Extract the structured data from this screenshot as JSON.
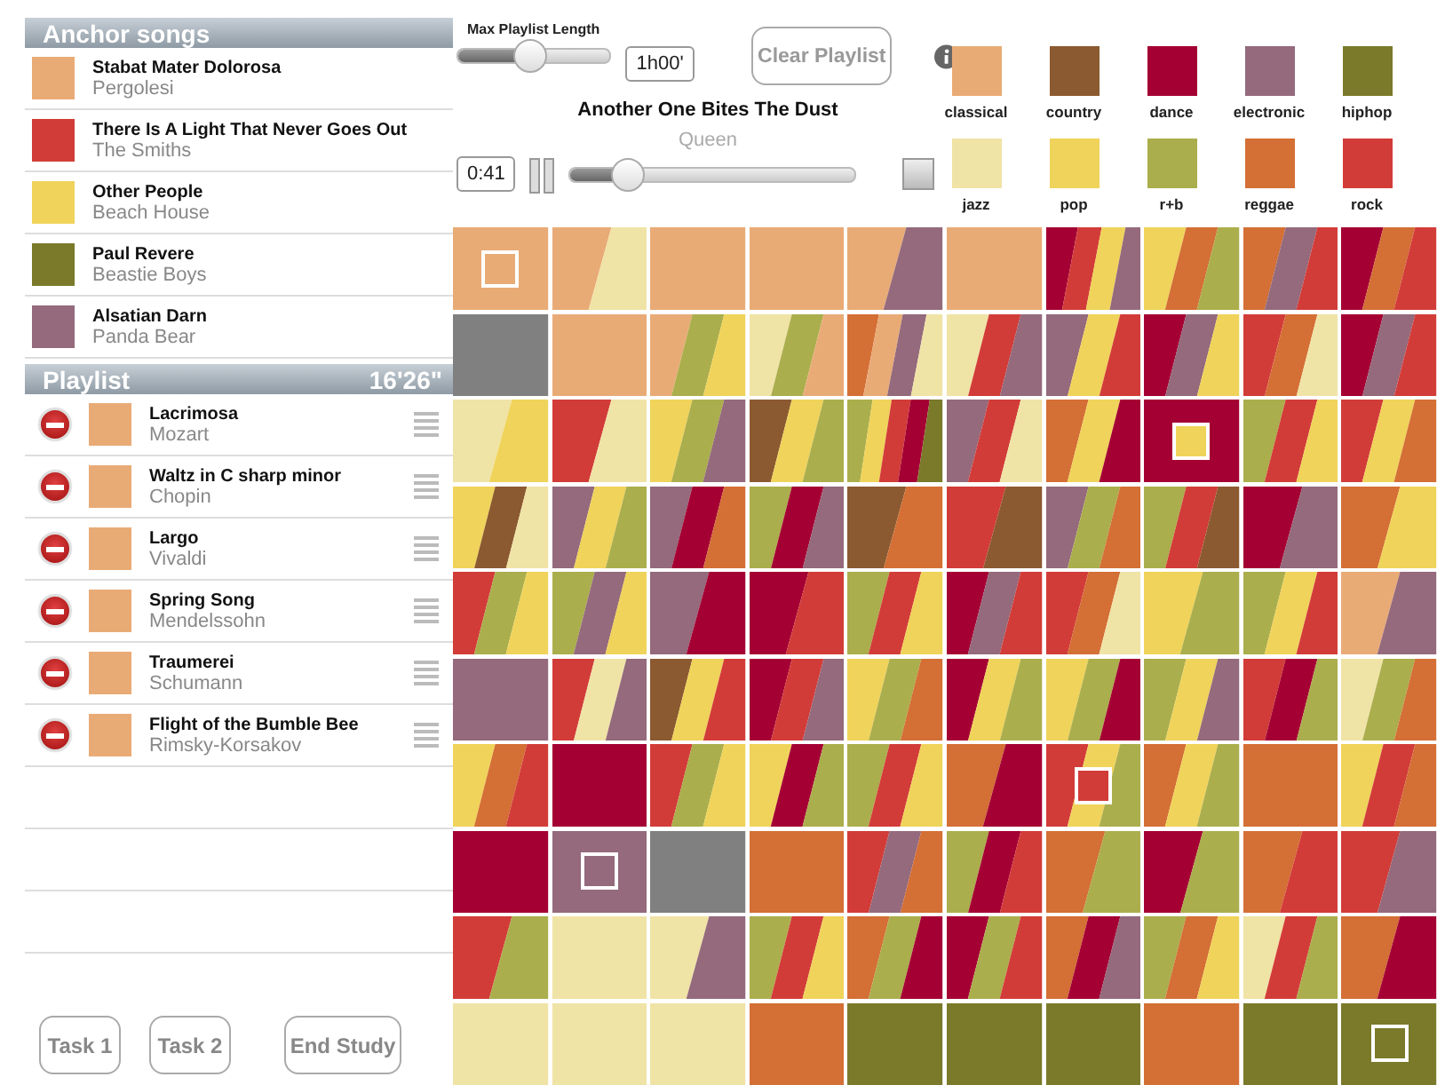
{
  "anchors": {
    "title": "Anchor songs",
    "songs": [
      {
        "title": "Stabat Mater Dolorosa",
        "artist": "Pergolesi",
        "color": "#e9ab76"
      },
      {
        "title": "There Is A Light That Never Goes Out",
        "artist": "The Smiths",
        "color": "#d23c38"
      },
      {
        "title": "Other People",
        "artist": "Beach House",
        "color": "#f0d35a"
      },
      {
        "title": "Paul Revere",
        "artist": "Beastie Boys",
        "color": "#7a7a2a"
      },
      {
        "title": "Alsatian Darn",
        "artist": "Panda Bear",
        "color": "#946a7c"
      }
    ]
  },
  "playlist": {
    "title": "Playlist",
    "duration": "16'26\"",
    "songs": [
      {
        "title": "Lacrimosa",
        "artist": "Mozart",
        "color": "#e9ab76"
      },
      {
        "title": "Waltz in C sharp minor",
        "artist": "Chopin",
        "color": "#e9ab76"
      },
      {
        "title": "Largo",
        "artist": "Vivaldi",
        "color": "#e9ab76"
      },
      {
        "title": "Spring Song",
        "artist": "Mendelssohn",
        "color": "#e9ab76"
      },
      {
        "title": "Traumerei",
        "artist": "Schumann",
        "color": "#e9ab76"
      },
      {
        "title": "Flight of the Bumble Bee",
        "artist": "Rimsky-Korsakov",
        "color": "#e9ab76"
      }
    ]
  },
  "buttons": [
    "Task 1",
    "Task 2",
    "End Study"
  ],
  "controls": {
    "max_length_label": "Max Playlist Length",
    "max_length": {
      "level": 0.47
    },
    "max_length_value": "1h00'",
    "clear_button": "Clear Playlist"
  },
  "player": {
    "title": "Another One Bites The Dust",
    "artist": "Queen",
    "time": "0:41",
    "progress": {
      "level": 0.2
    }
  },
  "genres": [
    {
      "name": "classical",
      "color": "#e9ab76"
    },
    {
      "name": "country",
      "color": "#8c5a30"
    },
    {
      "name": "dance",
      "color": "#a50033"
    },
    {
      "name": "electronic",
      "color": "#946a7c"
    },
    {
      "name": "hiphop",
      "color": "#7a7a2a"
    },
    {
      "name": "jazz",
      "color": "#f0e3a6"
    },
    {
      "name": "pop",
      "color": "#f0d35a"
    },
    {
      "name": "r+b",
      "color": "#abae4c"
    },
    {
      "name": "reggae",
      "color": "#d46f35"
    },
    {
      "name": "rock",
      "color": "#d23c38"
    }
  ],
  "grid": [
    {
      "bands": [
        {
          "color": "#e9ab76"
        }
      ],
      "anchor": true
    },
    {
      "bands": [
        {
          "color": "#e9ab76"
        },
        {
          "color": "#f0e3a6"
        }
      ],
      "anchor": false
    },
    {
      "bands": [
        {
          "color": "#e9ab76"
        }
      ],
      "anchor": false
    },
    {
      "bands": [
        {
          "color": "#e9ab76"
        }
      ],
      "anchor": false
    },
    {
      "bands": [
        {
          "color": "#e9ab76"
        },
        {
          "color": "#946a7c"
        }
      ],
      "anchor": false
    },
    {
      "bands": [
        {
          "color": "#e9ab76"
        }
      ],
      "anchor": false
    },
    {
      "bands": [
        {
          "color": "#a50033"
        },
        {
          "color": "#d23c38"
        },
        {
          "color": "#f0d35a"
        },
        {
          "color": "#946a7c"
        }
      ],
      "anchor": false
    },
    {
      "bands": [
        {
          "color": "#f0d35a"
        },
        {
          "color": "#d46f35"
        },
        {
          "color": "#abae4c"
        }
      ],
      "anchor": false
    },
    {
      "bands": [
        {
          "color": "#d46f35"
        },
        {
          "color": "#946a7c"
        },
        {
          "color": "#d23c38"
        }
      ],
      "anchor": false
    },
    {
      "bands": [
        {
          "color": "#a50033"
        },
        {
          "color": "#d46f35"
        },
        {
          "color": "#d23c38"
        }
      ],
      "anchor": false
    },
    {
      "bands": [
        {
          "color": "#808080"
        }
      ],
      "anchor": false
    },
    {
      "bands": [
        {
          "color": "#e9ab76"
        }
      ],
      "anchor": false
    },
    {
      "bands": [
        {
          "color": "#e9ab76"
        },
        {
          "color": "#abae4c"
        },
        {
          "color": "#f0d35a"
        }
      ],
      "anchor": false
    },
    {
      "bands": [
        {
          "color": "#f0e3a6"
        },
        {
          "color": "#abae4c"
        },
        {
          "color": "#e9ab76"
        }
      ],
      "anchor": false
    },
    {
      "bands": [
        {
          "color": "#d46f35"
        },
        {
          "color": "#e9ab76"
        },
        {
          "color": "#946a7c"
        },
        {
          "color": "#f0e3a6"
        }
      ],
      "anchor": false
    },
    {
      "bands": [
        {
          "color": "#f0e3a6"
        },
        {
          "color": "#d23c38"
        },
        {
          "color": "#946a7c"
        }
      ],
      "anchor": false
    },
    {
      "bands": [
        {
          "color": "#946a7c"
        },
        {
          "color": "#f0d35a"
        },
        {
          "color": "#d23c38"
        }
      ],
      "anchor": false
    },
    {
      "bands": [
        {
          "color": "#a50033"
        },
        {
          "color": "#946a7c"
        },
        {
          "color": "#f0d35a"
        }
      ],
      "anchor": false
    },
    {
      "bands": [
        {
          "color": "#d23c38"
        },
        {
          "color": "#d46f35"
        },
        {
          "color": "#f0e3a6"
        }
      ],
      "anchor": false
    },
    {
      "bands": [
        {
          "color": "#a50033"
        },
        {
          "color": "#946a7c"
        },
        {
          "color": "#d23c38"
        }
      ],
      "anchor": false
    },
    {
      "bands": [
        {
          "color": "#f0e3a6"
        },
        {
          "color": "#f0d35a"
        }
      ],
      "anchor": false
    },
    {
      "bands": [
        {
          "color": "#d23c38"
        },
        {
          "color": "#f0e3a6"
        }
      ],
      "anchor": false
    },
    {
      "bands": [
        {
          "color": "#f0d35a"
        },
        {
          "color": "#abae4c"
        },
        {
          "color": "#946a7c"
        }
      ],
      "anchor": false
    },
    {
      "bands": [
        {
          "color": "#8c5a30"
        },
        {
          "color": "#f0d35a"
        },
        {
          "color": "#abae4c"
        }
      ],
      "anchor": false
    },
    {
      "bands": [
        {
          "color": "#abae4c"
        },
        {
          "color": "#f0d35a"
        },
        {
          "color": "#d23c38"
        },
        {
          "color": "#a50033"
        },
        {
          "color": "#7a7a2a"
        }
      ],
      "anchor": false
    },
    {
      "bands": [
        {
          "color": "#946a7c"
        },
        {
          "color": "#d23c38"
        },
        {
          "color": "#f0e3a6"
        }
      ],
      "anchor": false
    },
    {
      "bands": [
        {
          "color": "#d46f35"
        },
        {
          "color": "#f0d35a"
        },
        {
          "color": "#a50033"
        }
      ],
      "anchor": false
    },
    {
      "bands": [
        {
          "color": "#a50033"
        }
      ],
      "anchor": true,
      "marker": {
        "color": "#f0d35a"
      }
    },
    {
      "bands": [
        {
          "color": "#abae4c"
        },
        {
          "color": "#d23c38"
        },
        {
          "color": "#f0d35a"
        }
      ],
      "anchor": false
    },
    {
      "bands": [
        {
          "color": "#d23c38"
        },
        {
          "color": "#f0d35a"
        },
        {
          "color": "#d46f35"
        }
      ],
      "anchor": false
    },
    {
      "bands": [
        {
          "color": "#f0d35a"
        },
        {
          "color": "#8c5a30"
        },
        {
          "color": "#f0e3a6"
        }
      ],
      "anchor": false
    },
    {
      "bands": [
        {
          "color": "#946a7c"
        },
        {
          "color": "#f0d35a"
        },
        {
          "color": "#abae4c"
        }
      ],
      "anchor": false
    },
    {
      "bands": [
        {
          "color": "#946a7c"
        },
        {
          "color": "#a50033"
        },
        {
          "color": "#d46f35"
        }
      ],
      "anchor": false
    },
    {
      "bands": [
        {
          "color": "#abae4c"
        },
        {
          "color": "#a50033"
        },
        {
          "color": "#946a7c"
        }
      ],
      "anchor": false
    },
    {
      "bands": [
        {
          "color": "#8c5a30"
        },
        {
          "color": "#d46f35"
        }
      ],
      "anchor": false
    },
    {
      "bands": [
        {
          "color": "#d23c38"
        },
        {
          "color": "#8c5a30"
        }
      ],
      "anchor": false
    },
    {
      "bands": [
        {
          "color": "#946a7c"
        },
        {
          "color": "#abae4c"
        },
        {
          "color": "#d46f35"
        }
      ],
      "anchor": false
    },
    {
      "bands": [
        {
          "color": "#abae4c"
        },
        {
          "color": "#d23c38"
        },
        {
          "color": "#8c5a30"
        }
      ],
      "anchor": false
    },
    {
      "bands": [
        {
          "color": "#a50033"
        },
        {
          "color": "#946a7c"
        }
      ],
      "anchor": false
    },
    {
      "bands": [
        {
          "color": "#d46f35"
        },
        {
          "color": "#f0d35a"
        }
      ],
      "anchor": false
    },
    {
      "bands": [
        {
          "color": "#d23c38"
        },
        {
          "color": "#abae4c"
        },
        {
          "color": "#f0d35a"
        }
      ],
      "anchor": false
    },
    {
      "bands": [
        {
          "color": "#abae4c"
        },
        {
          "color": "#946a7c"
        },
        {
          "color": "#f0d35a"
        }
      ],
      "anchor": false
    },
    {
      "bands": [
        {
          "color": "#946a7c"
        },
        {
          "color": "#a50033"
        }
      ],
      "anchor": false
    },
    {
      "bands": [
        {
          "color": "#a50033"
        },
        {
          "color": "#d23c38"
        }
      ],
      "anchor": false
    },
    {
      "bands": [
        {
          "color": "#abae4c"
        },
        {
          "color": "#d23c38"
        },
        {
          "color": "#f0d35a"
        }
      ],
      "anchor": false
    },
    {
      "bands": [
        {
          "color": "#a50033"
        },
        {
          "color": "#946a7c"
        },
        {
          "color": "#d23c38"
        }
      ],
      "anchor": false
    },
    {
      "bands": [
        {
          "color": "#d23c38"
        },
        {
          "color": "#d46f35"
        },
        {
          "color": "#f0e3a6"
        }
      ],
      "anchor": false
    },
    {
      "bands": [
        {
          "color": "#f0d35a"
        },
        {
          "color": "#abae4c"
        }
      ],
      "anchor": false
    },
    {
      "bands": [
        {
          "color": "#abae4c"
        },
        {
          "color": "#f0d35a"
        },
        {
          "color": "#d23c38"
        }
      ],
      "anchor": false
    },
    {
      "bands": [
        {
          "color": "#e9ab76"
        },
        {
          "color": "#946a7c"
        }
      ],
      "anchor": false
    },
    {
      "bands": [
        {
          "color": "#946a7c"
        }
      ],
      "anchor": false
    },
    {
      "bands": [
        {
          "color": "#d23c38"
        },
        {
          "color": "#f0e3a6"
        },
        {
          "color": "#946a7c"
        }
      ],
      "anchor": false
    },
    {
      "bands": [
        {
          "color": "#8c5a30"
        },
        {
          "color": "#f0d35a"
        },
        {
          "color": "#d23c38"
        }
      ],
      "anchor": false
    },
    {
      "bands": [
        {
          "color": "#a50033"
        },
        {
          "color": "#d23c38"
        },
        {
          "color": "#946a7c"
        }
      ],
      "anchor": false
    },
    {
      "bands": [
        {
          "color": "#f0d35a"
        },
        {
          "color": "#abae4c"
        },
        {
          "color": "#d46f35"
        }
      ],
      "anchor": false
    },
    {
      "bands": [
        {
          "color": "#a50033"
        },
        {
          "color": "#f0d35a"
        },
        {
          "color": "#abae4c"
        }
      ],
      "anchor": false
    },
    {
      "bands": [
        {
          "color": "#f0d35a"
        },
        {
          "color": "#abae4c"
        },
        {
          "color": "#a50033"
        }
      ],
      "anchor": false
    },
    {
      "bands": [
        {
          "color": "#abae4c"
        },
        {
          "color": "#f0d35a"
        },
        {
          "color": "#946a7c"
        }
      ],
      "anchor": false
    },
    {
      "bands": [
        {
          "color": "#d23c38"
        },
        {
          "color": "#a50033"
        },
        {
          "color": "#abae4c"
        }
      ],
      "anchor": false
    },
    {
      "bands": [
        {
          "color": "#f0e3a6"
        },
        {
          "color": "#abae4c"
        },
        {
          "color": "#d46f35"
        }
      ],
      "anchor": false
    },
    {
      "bands": [
        {
          "color": "#f0d35a"
        },
        {
          "color": "#d46f35"
        },
        {
          "color": "#d23c38"
        }
      ],
      "anchor": false
    },
    {
      "bands": [
        {
          "color": "#a50033"
        }
      ],
      "anchor": false
    },
    {
      "bands": [
        {
          "color": "#d23c38"
        },
        {
          "color": "#abae4c"
        },
        {
          "color": "#f0d35a"
        }
      ],
      "anchor": false
    },
    {
      "bands": [
        {
          "color": "#f0d35a"
        },
        {
          "color": "#a50033"
        },
        {
          "color": "#abae4c"
        }
      ],
      "anchor": false
    },
    {
      "bands": [
        {
          "color": "#abae4c"
        },
        {
          "color": "#d23c38"
        },
        {
          "color": "#f0d35a"
        }
      ],
      "anchor": false
    },
    {
      "bands": [
        {
          "color": "#d46f35"
        },
        {
          "color": "#a50033"
        }
      ],
      "anchor": false
    },
    {
      "bands": [
        {
          "color": "#d23c38"
        },
        {
          "color": "#f0d35a"
        },
        {
          "color": "#abae4c"
        }
      ],
      "anchor": true,
      "marker": {
        "color": "#d23c38"
      }
    },
    {
      "bands": [
        {
          "color": "#d46f35"
        },
        {
          "color": "#f0d35a"
        },
        {
          "color": "#abae4c"
        }
      ],
      "anchor": false
    },
    {
      "bands": [
        {
          "color": "#d46f35"
        }
      ],
      "anchor": false
    },
    {
      "bands": [
        {
          "color": "#f0d35a"
        },
        {
          "color": "#d23c38"
        },
        {
          "color": "#d46f35"
        }
      ],
      "anchor": false
    },
    {
      "bands": [
        {
          "color": "#a50033"
        }
      ],
      "anchor": false
    },
    {
      "bands": [
        {
          "color": "#946a7c"
        }
      ],
      "anchor": true
    },
    {
      "bands": [
        {
          "color": "#808080"
        }
      ],
      "anchor": false
    },
    {
      "bands": [
        {
          "color": "#d46f35"
        }
      ],
      "anchor": false
    },
    {
      "bands": [
        {
          "color": "#d23c38"
        },
        {
          "color": "#946a7c"
        },
        {
          "color": "#d46f35"
        }
      ],
      "anchor": false
    },
    {
      "bands": [
        {
          "color": "#abae4c"
        },
        {
          "color": "#a50033"
        },
        {
          "color": "#d23c38"
        }
      ],
      "anchor": false
    },
    {
      "bands": [
        {
          "color": "#d46f35"
        },
        {
          "color": "#abae4c"
        }
      ],
      "anchor": false
    },
    {
      "bands": [
        {
          "color": "#a50033"
        },
        {
          "color": "#abae4c"
        }
      ],
      "anchor": false
    },
    {
      "bands": [
        {
          "color": "#d46f35"
        },
        {
          "color": "#d23c38"
        }
      ],
      "anchor": false
    },
    {
      "bands": [
        {
          "color": "#d23c38"
        },
        {
          "color": "#946a7c"
        }
      ],
      "anchor": false
    },
    {
      "bands": [
        {
          "color": "#d23c38"
        },
        {
          "color": "#abae4c"
        }
      ],
      "anchor": false
    },
    {
      "bands": [
        {
          "color": "#f0e3a6"
        }
      ],
      "anchor": false
    },
    {
      "bands": [
        {
          "color": "#f0e3a6"
        },
        {
          "color": "#946a7c"
        }
      ],
      "anchor": false
    },
    {
      "bands": [
        {
          "color": "#abae4c"
        },
        {
          "color": "#d23c38"
        },
        {
          "color": "#f0d35a"
        }
      ],
      "anchor": false
    },
    {
      "bands": [
        {
          "color": "#d46f35"
        },
        {
          "color": "#abae4c"
        },
        {
          "color": "#a50033"
        }
      ],
      "anchor": false
    },
    {
      "bands": [
        {
          "color": "#a50033"
        },
        {
          "color": "#abae4c"
        },
        {
          "color": "#d23c38"
        }
      ],
      "anchor": false
    },
    {
      "bands": [
        {
          "color": "#d46f35"
        },
        {
          "color": "#a50033"
        },
        {
          "color": "#946a7c"
        }
      ],
      "anchor": false
    },
    {
      "bands": [
        {
          "color": "#abae4c"
        },
        {
          "color": "#d46f35"
        },
        {
          "color": "#f0d35a"
        }
      ],
      "anchor": false
    },
    {
      "bands": [
        {
          "color": "#f0e3a6"
        },
        {
          "color": "#d23c38"
        },
        {
          "color": "#abae4c"
        }
      ],
      "anchor": false
    },
    {
      "bands": [
        {
          "color": "#d46f35"
        },
        {
          "color": "#a50033"
        }
      ],
      "anchor": false
    },
    {
      "bands": [
        {
          "color": "#f0e3a6"
        }
      ],
      "anchor": false
    },
    {
      "bands": [
        {
          "color": "#f0e3a6"
        }
      ],
      "anchor": false
    },
    {
      "bands": [
        {
          "color": "#f0e3a6"
        }
      ],
      "anchor": false
    },
    {
      "bands": [
        {
          "color": "#d46f35"
        }
      ],
      "anchor": false
    },
    {
      "bands": [
        {
          "color": "#7a7a2a"
        }
      ],
      "anchor": false
    },
    {
      "bands": [
        {
          "color": "#7a7a2a"
        }
      ],
      "anchor": false
    },
    {
      "bands": [
        {
          "color": "#7a7a2a"
        }
      ],
      "anchor": false
    },
    {
      "bands": [
        {
          "color": "#d46f35"
        }
      ],
      "anchor": false
    },
    {
      "bands": [
        {
          "color": "#7a7a2a"
        }
      ],
      "anchor": false
    },
    {
      "bands": [
        {
          "color": "#7a7a2a"
        }
      ],
      "anchor": true
    }
  ]
}
